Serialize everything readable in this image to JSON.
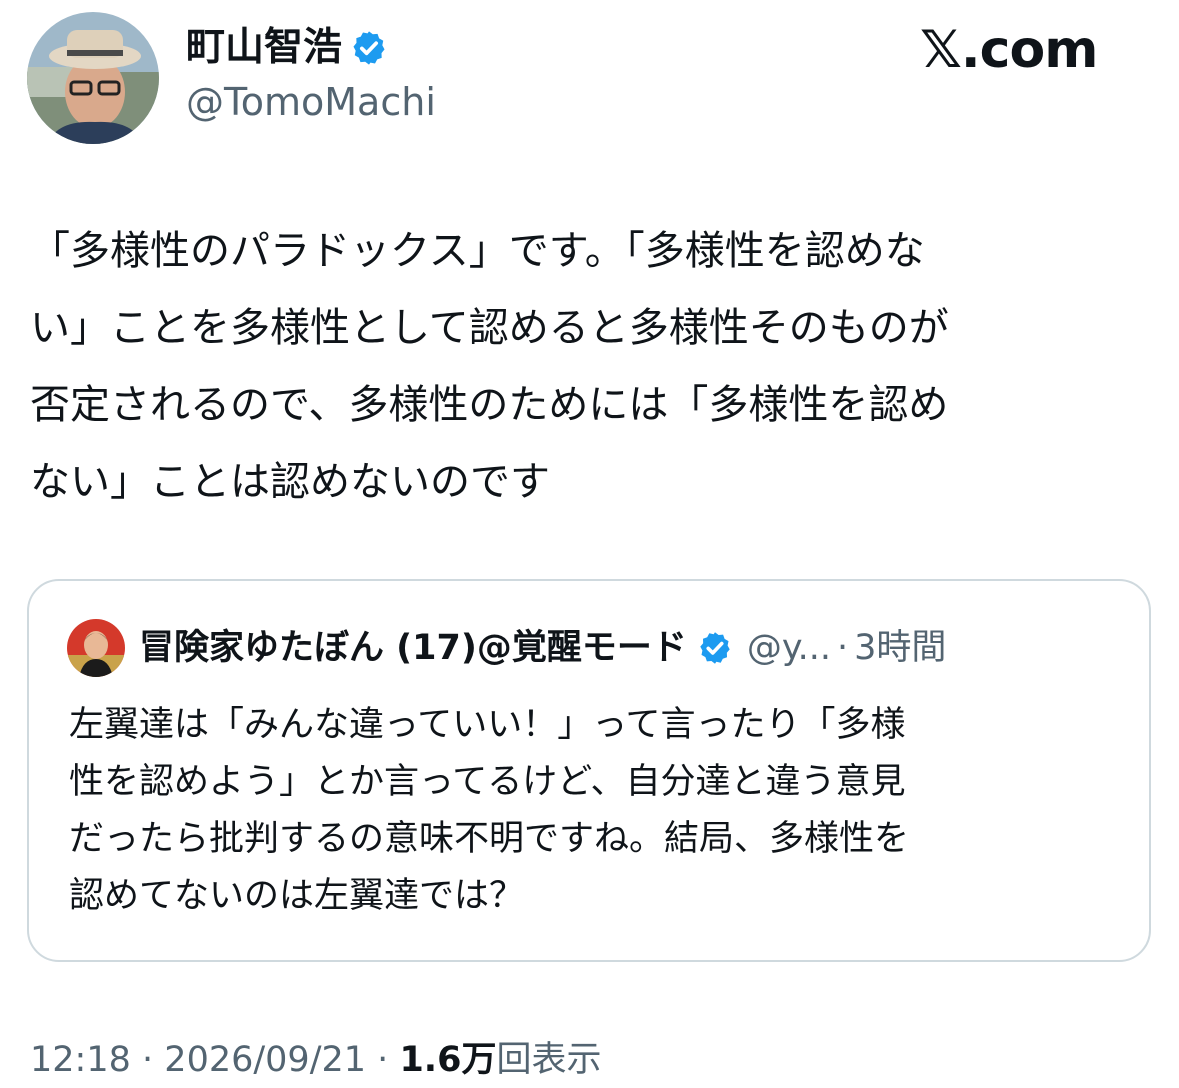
{
  "author": {
    "display_name": "町山智浩",
    "handle": "@TomoMachi",
    "verified_color": "#1d9bf0"
  },
  "site": {
    "logo_text": "𝕏.com"
  },
  "tweet": {
    "lines": [
      "「多様性のパラドックス」です。「多様性を認めな",
      "い」ことを多様性として認めると多様性そのものが",
      "否定されるので、多様性のためには「多様性を認め",
      "ない」ことは認めないのです"
    ]
  },
  "quote": {
    "display_name": "冒険家ゆたぼん (17)@覚醒モード",
    "handle": "@y...",
    "separator": "·",
    "time": "3時間",
    "lines": [
      "左翼達は「みんな違っていい！」って言ったり「多様",
      "性を認めよう」とか言ってるけど、自分達と違う意見",
      "だったら批判するの意味不明ですね。結局、多様性を",
      "認めてないのは左翼達では？"
    ]
  },
  "meta": {
    "time": "12:18",
    "sep1": "·",
    "date": "2026/09/21",
    "sep2": "·",
    "views_count": "1.6万",
    "views_label": "回表示"
  }
}
